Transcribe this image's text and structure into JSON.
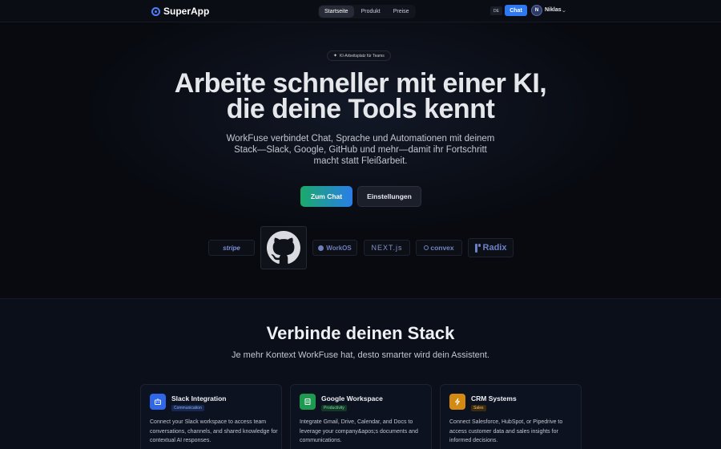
{
  "header": {
    "brand": "SuperApp",
    "nav": [
      {
        "label": "Startseite",
        "active": true
      },
      {
        "label": "Produkt",
        "active": false
      },
      {
        "label": "Preise",
        "active": false
      }
    ],
    "lang": "DE",
    "chat_label": "Chat",
    "avatar_initial": "N",
    "user_name": "Niklas"
  },
  "hero": {
    "badge": "KI-Arbeitsplatz für Teams",
    "title_line1": "Arbeite schneller mit einer KI,",
    "title_line2": "die deine Tools kennt",
    "subtitle": "WorkFuse verbindet Chat, Sprache und Automationen mit deinem Stack—Slack, Google, GitHub und mehr—damit ihr Fortschritt macht statt Fleißarbeit.",
    "primary_button": "Zum Chat",
    "secondary_button": "Einstellungen",
    "logos": [
      "stripe",
      "github",
      "WorkOS",
      "NEXT.js",
      "convex",
      "Radix"
    ]
  },
  "integrations": {
    "title": "Verbinde deinen Stack",
    "subtitle": "Je mehr Kontext WorkFuse hat, desto smarter wird dein Assistent.",
    "cards": [
      {
        "title": "Slack Integration",
        "tag": "Communication",
        "description": "Connect your Slack workspace to access team conversations, channels, and shared knowledge for contextual AI responses.",
        "icon": "robot-icon",
        "color": "#2f67e8"
      },
      {
        "title": "Google Workspace",
        "tag": "Productivity",
        "description": "Integrate Gmail, Drive, Calendar, and Docs to leverage your company&apos;s documents and communications.",
        "icon": "building-icon",
        "color": "#1d9a50"
      },
      {
        "title": "CRM Systems",
        "tag": "Sales",
        "description": "Connect Salesforce, HubSpot, or Pipedrive to access customer data and sales insights for informed decisions.",
        "icon": "lightning-icon",
        "color": "#d38a12"
      }
    ]
  }
}
